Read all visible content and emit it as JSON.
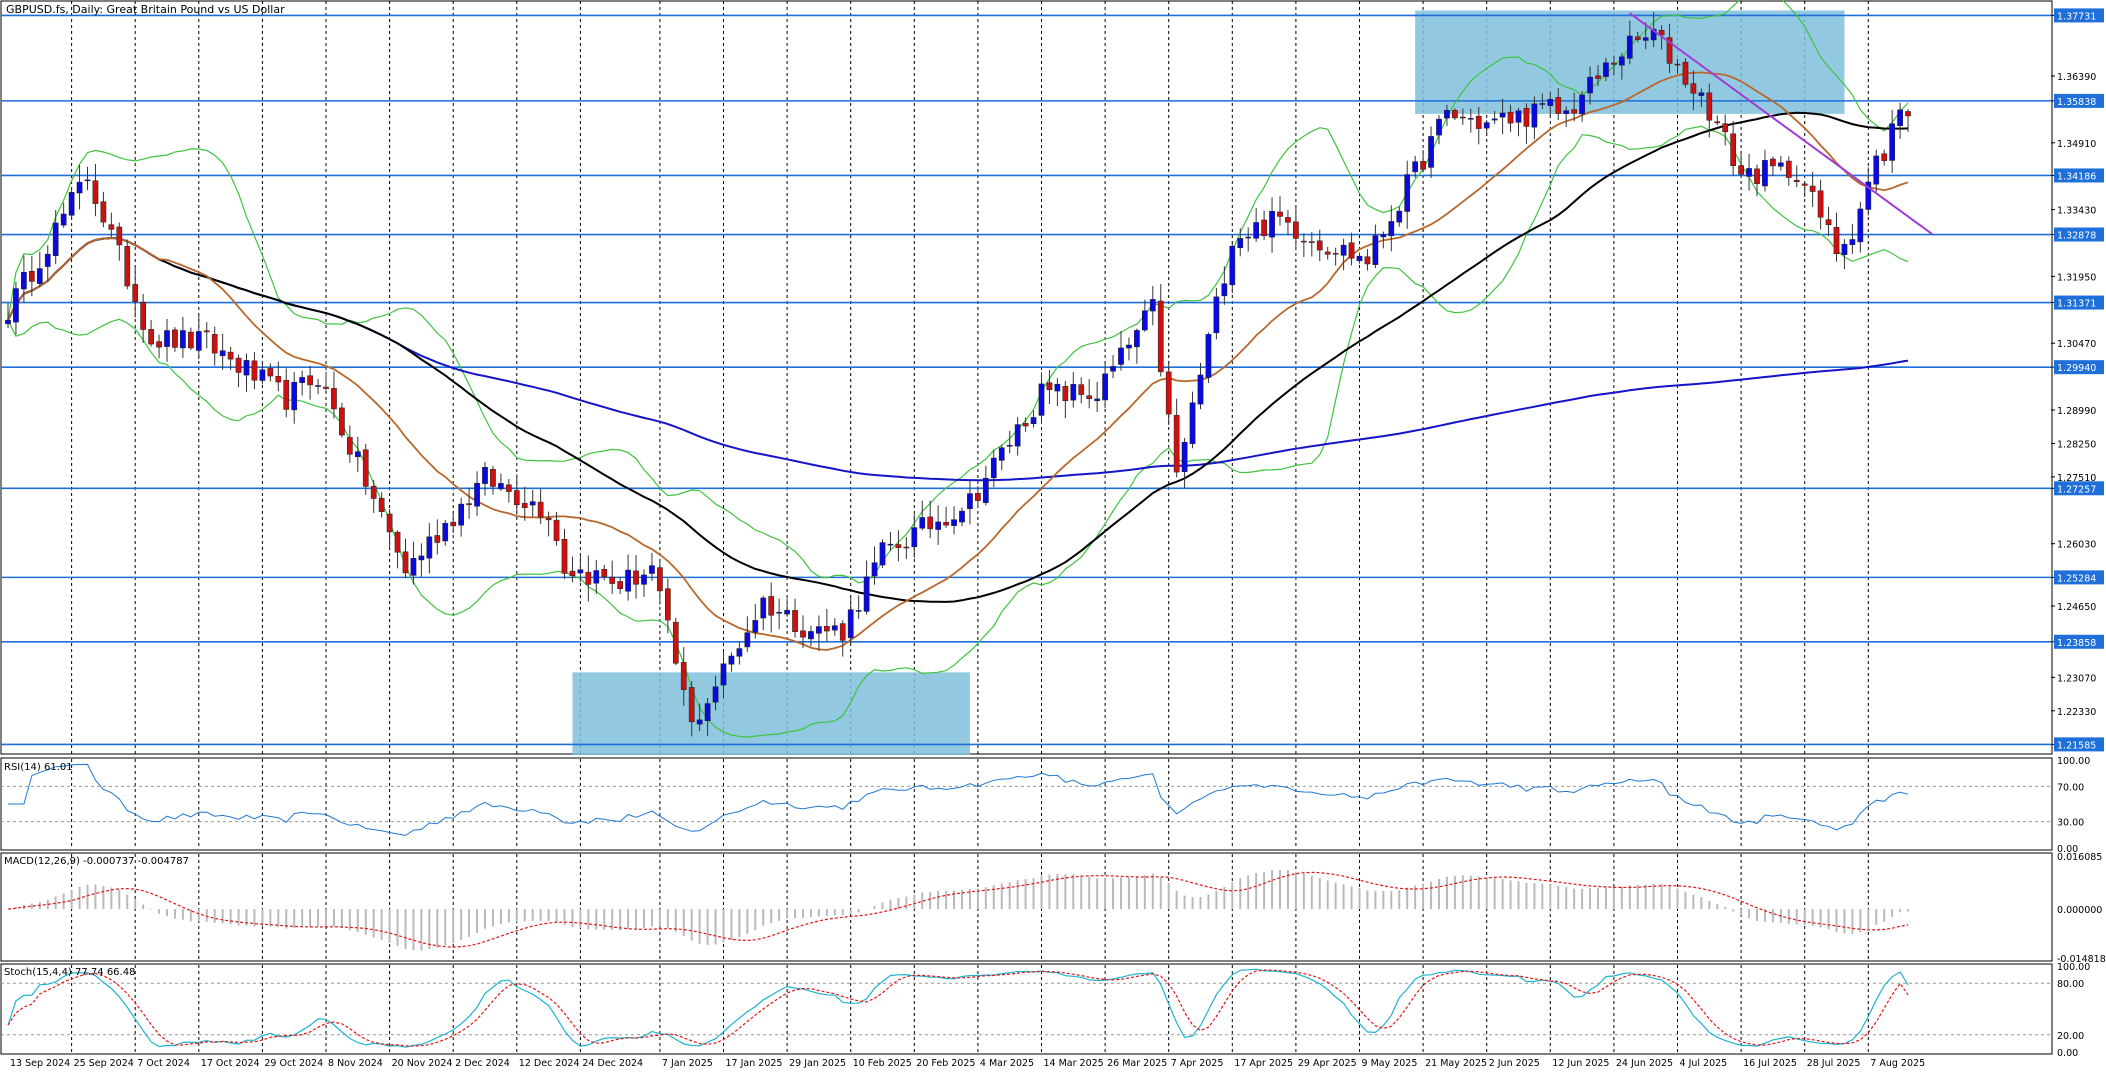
{
  "colors": {
    "background": "#ffffff",
    "axis": "#000000",
    "grid": "#000000",
    "bull": "#0a0ae0",
    "bear": "#cc1111",
    "level_line": "#1e6fd9",
    "level_label_bg": "#1e6fd9",
    "zone_fill": "#7fc0dc",
    "ma_fast": "#b8682c",
    "ma_mid": "#000000",
    "ma_slow": "#1414c8",
    "bollinger": "#3fc33f",
    "trendline": "#a03cd2",
    "rsi": "#1e78d2",
    "macd_hist": "#b9b9b9",
    "macd_signal": "#e01818",
    "stoch_main": "#1eb4d2",
    "stoch_signal": "#e01818"
  },
  "main": {
    "title": "GBPUSD.fs, Daily:  Great Britain Pound vs US Dollar",
    "price_ticks": [
      "1.37731",
      "1.36390",
      "1.35838",
      "1.34910",
      "1.34186",
      "1.33430",
      "1.32878",
      "1.31950",
      "1.31371",
      "1.30470",
      "1.29940",
      "1.28990",
      "1.28250",
      "1.27510",
      "1.27257",
      "1.26030",
      "1.25284",
      "1.24650",
      "1.23858",
      "1.23070",
      "1.22330",
      "1.21585"
    ]
  },
  "x_axis": {
    "dates": [
      "13 Sep 2024",
      "25 Sep 2024",
      "7 Oct 2024",
      "17 Oct 2024",
      "29 Oct 2024",
      "8 Nov 2024",
      "20 Nov 2024",
      "2 Dec 2024",
      "12 Dec 2024",
      "24 Dec 2024",
      "7 Jan 2025",
      "17 Jan 2025",
      "29 Jan 2025",
      "10 Feb 2025",
      "20 Feb 2025",
      "4 Mar 2025",
      "14 Mar 2025",
      "26 Mar 2025",
      "7 Apr 2025",
      "17 Apr 2025",
      "29 Apr 2025",
      "9 May 2025",
      "21 May 2025",
      "2 Jun 2025",
      "12 Jun 2025",
      "24 Jun 2025",
      "4 Jul 2025",
      "16 Jul 2025",
      "28 Jul 2025",
      "7 Aug 2025"
    ]
  },
  "rsi": {
    "label": "RSI(14) 61.01",
    "ticks": [
      "100.00",
      "70.00",
      "30.00",
      "0.00"
    ]
  },
  "macd": {
    "label": "MACD(12,26,9) -0.000737 -0.004787",
    "ticks": [
      "0.016085",
      "0.000000",
      "-0.014818"
    ]
  },
  "stoch": {
    "label": "Stoch(15,4,4) 77.74 66.48",
    "ticks": [
      "100.00",
      "80.00",
      "20.00",
      "0.00"
    ]
  },
  "chart_data": {
    "type": "candlestick",
    "symbol": "GBPUSD.fs",
    "timeframe": "Daily",
    "title": "GBPUSD.fs, Daily:  Great Britain Pound vs US Dollar",
    "x_range": [
      "13 Sep 2024",
      "12 Aug 2025"
    ],
    "ylim": [
      1.2135,
      1.3805
    ],
    "horizontal_levels": [
      1.37731,
      1.35838,
      1.34186,
      1.32878,
      1.31371,
      1.2994,
      1.27257,
      1.25284,
      1.23858,
      1.21585
    ],
    "zones": [
      {
        "from": "23 Dec 2024",
        "to": "3 Mar 2025",
        "low": 1.2135,
        "high": 1.2318
      },
      {
        "from": "20 May 2025",
        "to": "4 Aug 2025",
        "low": 1.3555,
        "high": 1.3784
      }
    ],
    "trendline": {
      "from": [
        "26 Jun 2025",
        1.3778
      ],
      "to": [
        "12 Aug 2025",
        1.3333
      ]
    },
    "price_anchors": [
      [
        "13 Sep 2024",
        1.312
      ],
      [
        "27 Sep 2024",
        1.3418
      ],
      [
        "9 Oct 2024",
        1.3058
      ],
      [
        "18 Oct 2024",
        1.3048
      ],
      [
        "1 Nov 2024",
        1.2925
      ],
      [
        "7 Nov 2024",
        1.2975
      ],
      [
        "22 Nov 2024",
        1.2545
      ],
      [
        "6 Dec 2024",
        1.2748
      ],
      [
        "18 Dec 2024",
        1.2675
      ],
      [
        "20 Dec 2024",
        1.2552
      ],
      [
        "31 Dec 2024",
        1.2515
      ],
      [
        "6 Jan 2025",
        1.2547
      ],
      [
        "13 Jan 2025",
        1.2198
      ],
      [
        "24 Jan 2025",
        1.2475
      ],
      [
        "3 Feb 2025",
        1.2412
      ],
      [
        "7 Feb 2025",
        1.2412
      ],
      [
        "14 Feb 2025",
        1.2582
      ],
      [
        "3 Mar 2025",
        1.2698
      ],
      [
        "14 Mar 2025",
        1.2935
      ],
      [
        "25 Mar 2025",
        1.2935
      ],
      [
        "3 Apr 2025",
        1.3122
      ],
      [
        "8 Apr 2025",
        1.2752
      ],
      [
        "17 Apr 2025",
        1.3282
      ],
      [
        "25 Apr 2025",
        1.3322
      ],
      [
        "2 May 2025",
        1.3272
      ],
      [
        "12 May 2025",
        1.3232
      ],
      [
        "26 May 2025",
        1.3555
      ],
      [
        "2 Jun 2025",
        1.3532
      ],
      [
        "12 Jun 2025",
        1.3566
      ],
      [
        "16 Jun 2025",
        1.3555
      ],
      [
        "25 Jun 2025",
        1.3695
      ],
      [
        "1 Jul 2025",
        1.3732
      ],
      [
        "10 Jul 2025",
        1.3565
      ],
      [
        "16 Jul 2025",
        1.3422
      ],
      [
        "25 Jul 2025",
        1.3432
      ],
      [
        "1 Aug 2025",
        1.3255
      ],
      [
        "5 Aug 2025",
        1.3302
      ],
      [
        "8 Aug 2025",
        1.3452
      ],
      [
        "11 Aug 2025",
        1.3438
      ],
      [
        "12 Aug 2025",
        1.3552
      ]
    ],
    "indicators": {
      "moving_averages": [
        "fast (brown)",
        "medium (black)",
        "slow (blue)"
      ],
      "bollinger_bands": true,
      "rsi": {
        "period": 14,
        "last": 61.01,
        "levels": [
          70,
          30
        ]
      },
      "macd": {
        "params": [
          12,
          26,
          9
        ],
        "main": -0.000737,
        "signal": -0.004787
      },
      "stochastic": {
        "params": [
          15,
          4,
          4
        ],
        "k": 77.74,
        "d": 66.48,
        "levels": [
          80,
          20
        ]
      }
    },
    "grid": true
  }
}
